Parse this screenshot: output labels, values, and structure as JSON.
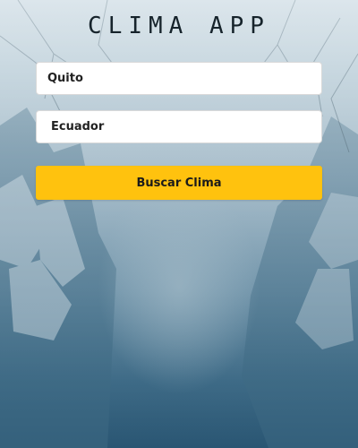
{
  "app": {
    "title": "CLIMA APP"
  },
  "form": {
    "city_value": "Quito",
    "country_value": "Ecuador",
    "submit_label": "Buscar Clima"
  },
  "colors": {
    "button_bg": "#ffc20e",
    "input_bg": "#ffffff",
    "title_text": "#16232b"
  }
}
